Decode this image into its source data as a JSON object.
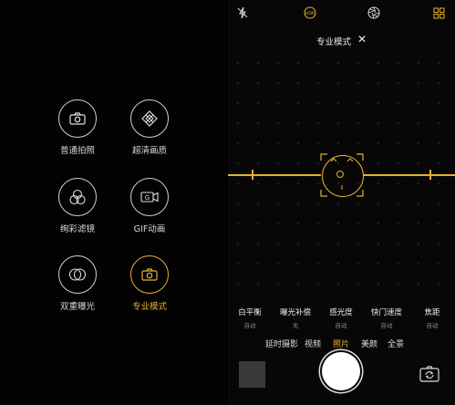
{
  "colors": {
    "accent": "#e6b12a",
    "text": "#dddddd",
    "muted": "#888888"
  },
  "modes": [
    {
      "label": "普通拍照",
      "icon": "camera-icon"
    },
    {
      "label": "超清画质",
      "icon": "diamond-icon"
    },
    {
      "label": "绚彩滤镜",
      "icon": "color-filter-icon"
    },
    {
      "label": "GIF动画",
      "icon": "gif-icon"
    },
    {
      "label": "双重曝光",
      "icon": "double-exposure-icon"
    },
    {
      "label": "专业模式",
      "icon": "pro-camera-icon",
      "active": true
    }
  ],
  "top_bar": {
    "icons": [
      "flash-off-icon",
      "hdr-icon",
      "aperture-icon",
      "grid-icon"
    ],
    "hdr_text": "HDR"
  },
  "pro_mode": {
    "title": "专业模式",
    "close": "✕"
  },
  "params": [
    {
      "label": "白平衡",
      "value": "自动"
    },
    {
      "label": "曝光补偿",
      "value": "无"
    },
    {
      "label": "感光度",
      "value": "自动"
    },
    {
      "label": "快门速度",
      "value": "自动"
    },
    {
      "label": "焦距",
      "value": "自动"
    }
  ],
  "camera_tabs": [
    {
      "label": "延时摄影"
    },
    {
      "label": "视频"
    },
    {
      "label": "照片",
      "active": true
    },
    {
      "label": "美颜"
    },
    {
      "label": "全景"
    }
  ],
  "bottom_icons": [
    "gallery-thumbnail",
    "shutter-button",
    "switch-camera-icon"
  ]
}
